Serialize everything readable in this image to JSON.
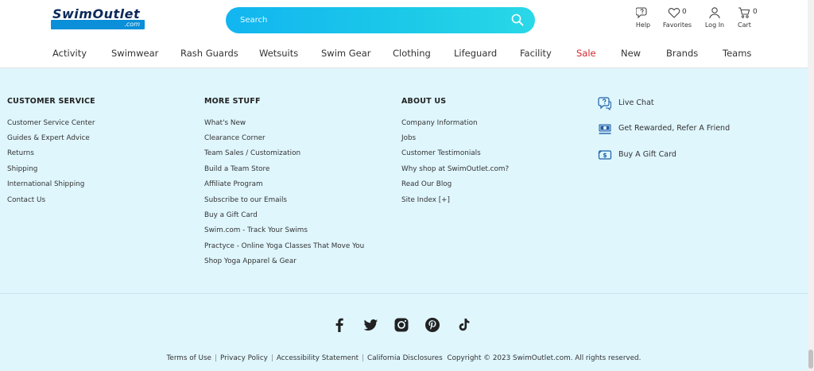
{
  "header": {
    "logo_main": "SwimOutlet",
    "logo_sub": ".com",
    "search_placeholder": "Search",
    "help_label": "Help",
    "favorites_label": "Favorites",
    "favorites_count": "0",
    "login_label": "Log In",
    "cart_label": "Cart",
    "cart_count": "0"
  },
  "nav": [
    "Activity",
    "Swimwear",
    "Rash Guards",
    "Wetsuits",
    "Swim Gear",
    "Clothing",
    "Lifeguard",
    "Facility",
    "Sale",
    "New",
    "Brands",
    "Teams"
  ],
  "colors": {
    "sale": "#d0282e",
    "footer_bg": "#dff6fd",
    "search_gradient_start": "#12b5f0",
    "search_gradient_end": "#2ad8e8",
    "logo_blue": "#0a8fd8"
  },
  "footer": {
    "customer_service": {
      "title": "CUSTOMER SERVICE",
      "links": [
        "Customer Service Center",
        "Guides & Expert Advice",
        "Returns",
        "Shipping",
        "International Shipping",
        "Contact Us"
      ]
    },
    "more_stuff": {
      "title": "MORE STUFF",
      "links": [
        "What's New",
        "Clearance Corner",
        "Team Sales / Customization",
        "Build a Team Store",
        "Affiliate Program",
        "Subscribe to our Emails",
        "Buy a Gift Card",
        "Swim.com - Track Your Swims",
        "Practyce - Online Yoga Classes That Move You",
        "Shop Yoga Apparel & Gear"
      ]
    },
    "about_us": {
      "title": "ABOUT US",
      "links": [
        "Company Information",
        "Jobs",
        "Customer Testimonials",
        "Why shop at SwimOutlet.com?",
        "Read Our Blog",
        "Site Index [+]"
      ]
    },
    "side": {
      "live_chat": "Live Chat",
      "rewards": "Get Rewarded, Refer A Friend",
      "gift_card": "Buy A Gift Card"
    },
    "social_icons": [
      "facebook-icon",
      "twitter-icon",
      "instagram-icon",
      "pinterest-icon",
      "tiktok-icon"
    ],
    "legal": {
      "terms": "Terms of Use",
      "privacy": "Privacy Policy",
      "accessibility": "Accessibility Statement",
      "california": "California Disclosures",
      "copyright": "Copyright © 2023 SwimOutlet.com. All rights reserved."
    }
  }
}
